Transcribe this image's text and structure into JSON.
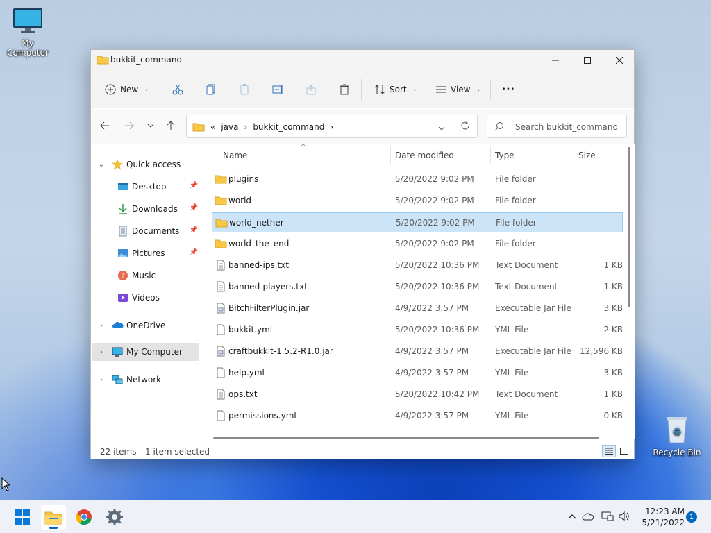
{
  "desktop": {
    "my_computer_label": "My Computer",
    "recycle_bin_label": "Recycle Bin"
  },
  "window": {
    "title": "bukkit_command",
    "toolbar": {
      "new_label": "New",
      "sort_label": "Sort",
      "view_label": "View",
      "more_label": "•••"
    },
    "address": {
      "overflow": "«",
      "crumbs": [
        "java",
        "bukkit_command"
      ]
    },
    "search": {
      "placeholder": "Search bukkit_command"
    },
    "nav": {
      "quick_access": "Quick access",
      "items": [
        {
          "label": "Desktop",
          "icon": "desktop-icon",
          "pinned": true
        },
        {
          "label": "Downloads",
          "icon": "downloads-icon",
          "pinned": true
        },
        {
          "label": "Documents",
          "icon": "documents-icon",
          "pinned": true
        },
        {
          "label": "Pictures",
          "icon": "pictures-icon",
          "pinned": true
        },
        {
          "label": "Music",
          "icon": "music-icon",
          "pinned": false
        },
        {
          "label": "Videos",
          "icon": "videos-icon",
          "pinned": false
        }
      ],
      "onedrive": "OneDrive",
      "my_computer": "My Computer",
      "network": "Network"
    },
    "columns": {
      "name": "Name",
      "date": "Date modified",
      "type": "Type",
      "size": "Size"
    },
    "files": [
      {
        "name": "plugins",
        "date": "5/20/2022 9:02 PM",
        "type": "File folder",
        "size": "",
        "kind": "folder"
      },
      {
        "name": "world",
        "date": "5/20/2022 9:02 PM",
        "type": "File folder",
        "size": "",
        "kind": "folder"
      },
      {
        "name": "world_nether",
        "date": "5/20/2022 9:02 PM",
        "type": "File folder",
        "size": "",
        "kind": "folder",
        "selected": true
      },
      {
        "name": "world_the_end",
        "date": "5/20/2022 9:02 PM",
        "type": "File folder",
        "size": "",
        "kind": "folder"
      },
      {
        "name": "banned-ips.txt",
        "date": "5/20/2022 10:36 PM",
        "type": "Text Document",
        "size": "1 KB",
        "kind": "text"
      },
      {
        "name": "banned-players.txt",
        "date": "5/20/2022 10:36 PM",
        "type": "Text Document",
        "size": "1 KB",
        "kind": "text"
      },
      {
        "name": "BitchFilterPlugin.jar",
        "date": "4/9/2022 3:57 PM",
        "type": "Executable Jar File",
        "size": "3 KB",
        "kind": "jar"
      },
      {
        "name": "bukkit.yml",
        "date": "5/20/2022 10:36 PM",
        "type": "YML File",
        "size": "2 KB",
        "kind": "file"
      },
      {
        "name": "craftbukkit-1.5.2-R1.0.jar",
        "date": "4/9/2022 3:57 PM",
        "type": "Executable Jar File",
        "size": "12,596 KB",
        "kind": "jar"
      },
      {
        "name": "help.yml",
        "date": "4/9/2022 3:57 PM",
        "type": "YML File",
        "size": "3 KB",
        "kind": "file"
      },
      {
        "name": "ops.txt",
        "date": "5/20/2022 10:42 PM",
        "type": "Text Document",
        "size": "1 KB",
        "kind": "text"
      },
      {
        "name": "permissions.yml",
        "date": "4/9/2022 3:57 PM",
        "type": "YML File",
        "size": "0 KB",
        "kind": "file"
      }
    ],
    "status": {
      "count": "22 items",
      "selection": "1 item selected"
    }
  },
  "taskbar": {
    "apps": [
      "start-icon",
      "file-explorer-icon",
      "chrome-icon",
      "settings-icon"
    ],
    "time": "12:23 AM",
    "date": "5/21/2022",
    "notifications": "1"
  },
  "colors": {
    "accent": "#0067c0",
    "selection_bg": "#cce4f7",
    "folder": "#f8c848"
  }
}
